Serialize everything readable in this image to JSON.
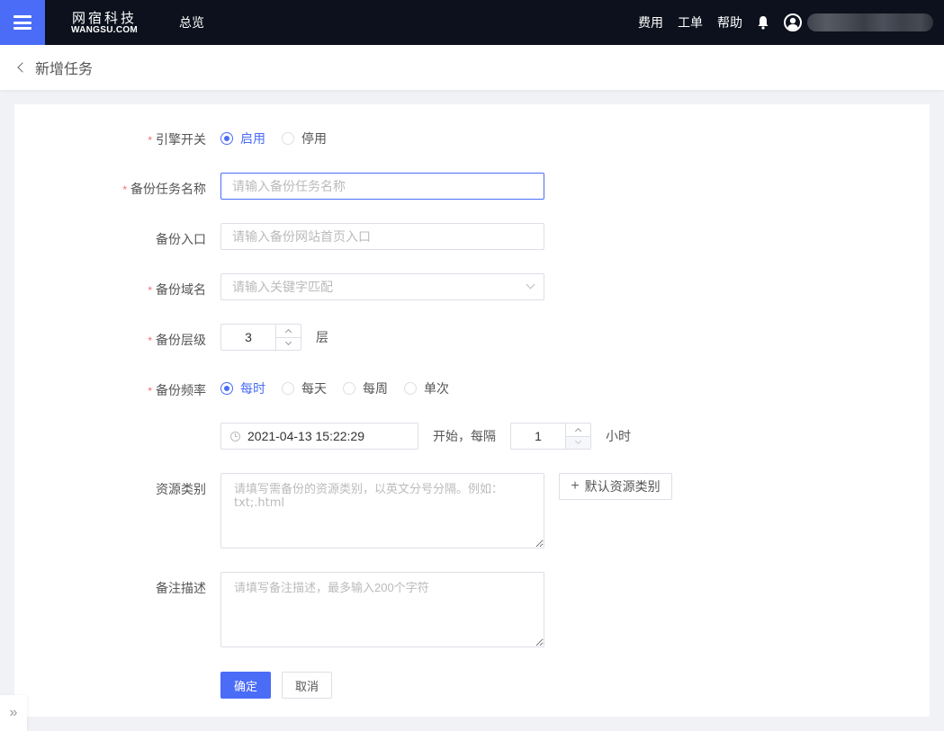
{
  "topbar": {
    "logo_cn": "网宿科技",
    "logo_en": "WANGSU.COM",
    "nav_overview": "总览",
    "links": [
      "费用",
      "工单",
      "帮助"
    ],
    "accent_color": "#4a6cf7"
  },
  "subheader": {
    "title": "新增任务"
  },
  "form": {
    "engine": {
      "label": "引擎开关",
      "required": "*",
      "options": [
        "启用",
        "停用"
      ],
      "selected": "启用"
    },
    "task_name": {
      "label": "备份任务名称",
      "required": "*",
      "placeholder": "请输入备份任务名称",
      "value": ""
    },
    "entry": {
      "label": "备份入口",
      "placeholder": "请输入备份网站首页入口",
      "value": ""
    },
    "domain": {
      "label": "备份域名",
      "required": "*",
      "placeholder": "请输入关键字匹配"
    },
    "level": {
      "label": "备份层级",
      "required": "*",
      "value": "3",
      "unit": "层"
    },
    "frequency": {
      "label": "备份频率",
      "required": "*",
      "options": [
        "每时",
        "每天",
        "每周",
        "单次"
      ],
      "selected": "每时",
      "start_datetime": "2021-04-13 15:22:29",
      "between_text": "开始，每隔",
      "interval_value": "1",
      "interval_unit": "小时"
    },
    "resource_type": {
      "label": "资源类别",
      "placeholder": "请填写需备份的资源类别，以英文分号分隔。例如：txt;.html",
      "default_button": "默认资源类别"
    },
    "remark": {
      "label": "备注描述",
      "placeholder": "请填写备注描述，最多输入200个字符"
    },
    "actions": {
      "confirm": "确定",
      "cancel": "取消"
    }
  },
  "sidebar_toggle": "»"
}
